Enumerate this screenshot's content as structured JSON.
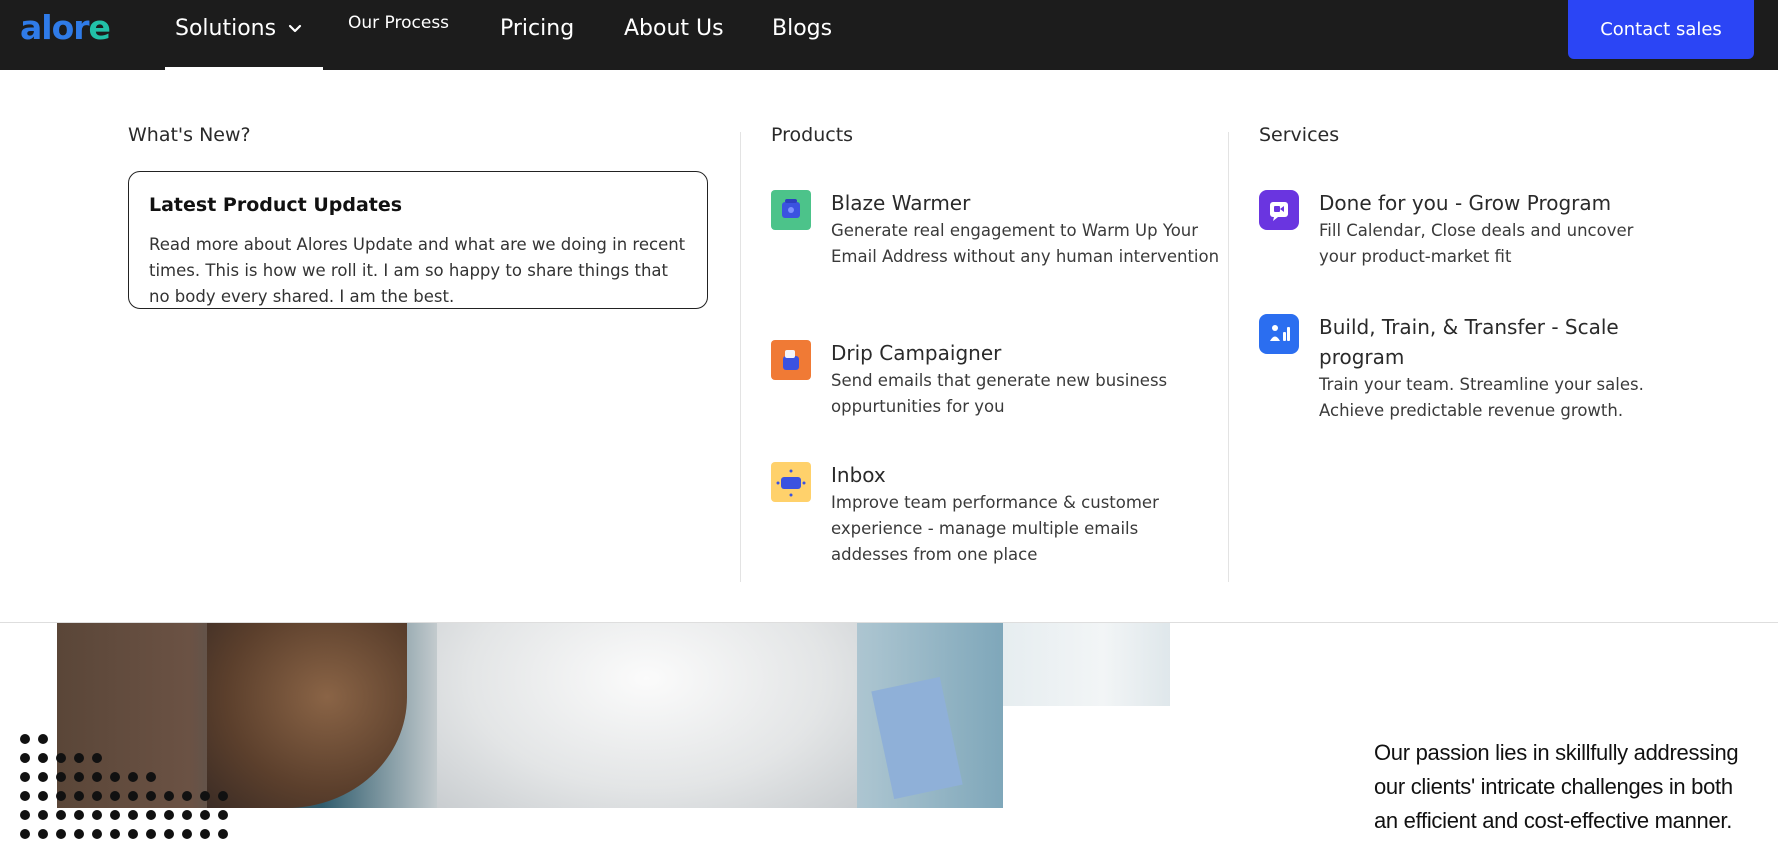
{
  "nav": {
    "logo": "alore",
    "solutions": "Solutions",
    "our_process": "Our Process",
    "pricing": "Pricing",
    "about_us": "About Us",
    "blogs": "Blogs",
    "contact_sales": "Contact sales"
  },
  "menu": {
    "whats_new": {
      "title": "What's New?",
      "card_title": "Latest Product Updates",
      "card_text": "Read more about Alores Update and what are we doing in recent times. This is how we roll it. I am so happy to share things that no body every shared. I am the best."
    },
    "products": {
      "title": "Products",
      "items": [
        {
          "title": "Blaze Warmer",
          "desc": "Generate real engagement to Warm Up Your Email Address without any human intervention",
          "icon": "blaze-warmer-icon",
          "color": "#4cc38a"
        },
        {
          "title": "Drip Campaigner",
          "desc": "Send emails that generate new business oppurtunities for you",
          "icon": "drip-campaigner-icon",
          "color": "#f07a35"
        },
        {
          "title": "Inbox",
          "desc": "Improve team performance & customer experience - manage multiple emails addesses from one place",
          "icon": "inbox-icon",
          "color": "#ffd16b"
        }
      ]
    },
    "services": {
      "title": "Services",
      "items": [
        {
          "title": "Done for you - Grow Program",
          "desc": "Fill Calendar, Close deals and uncover your product-market fit",
          "icon": "video-chat-icon",
          "color": "#6a35e0"
        },
        {
          "title": "Build, Train, & Transfer - Scale program",
          "desc": "Train your team. Streamline your sales. Achieve predictable revenue growth.",
          "icon": "team-growth-icon",
          "color": "#2b6ef0"
        }
      ]
    }
  },
  "hero": {
    "passion_text": "Our passion lies in skillfully addressing our clients' intricate challenges in both an efficient and cost-effective manner."
  }
}
